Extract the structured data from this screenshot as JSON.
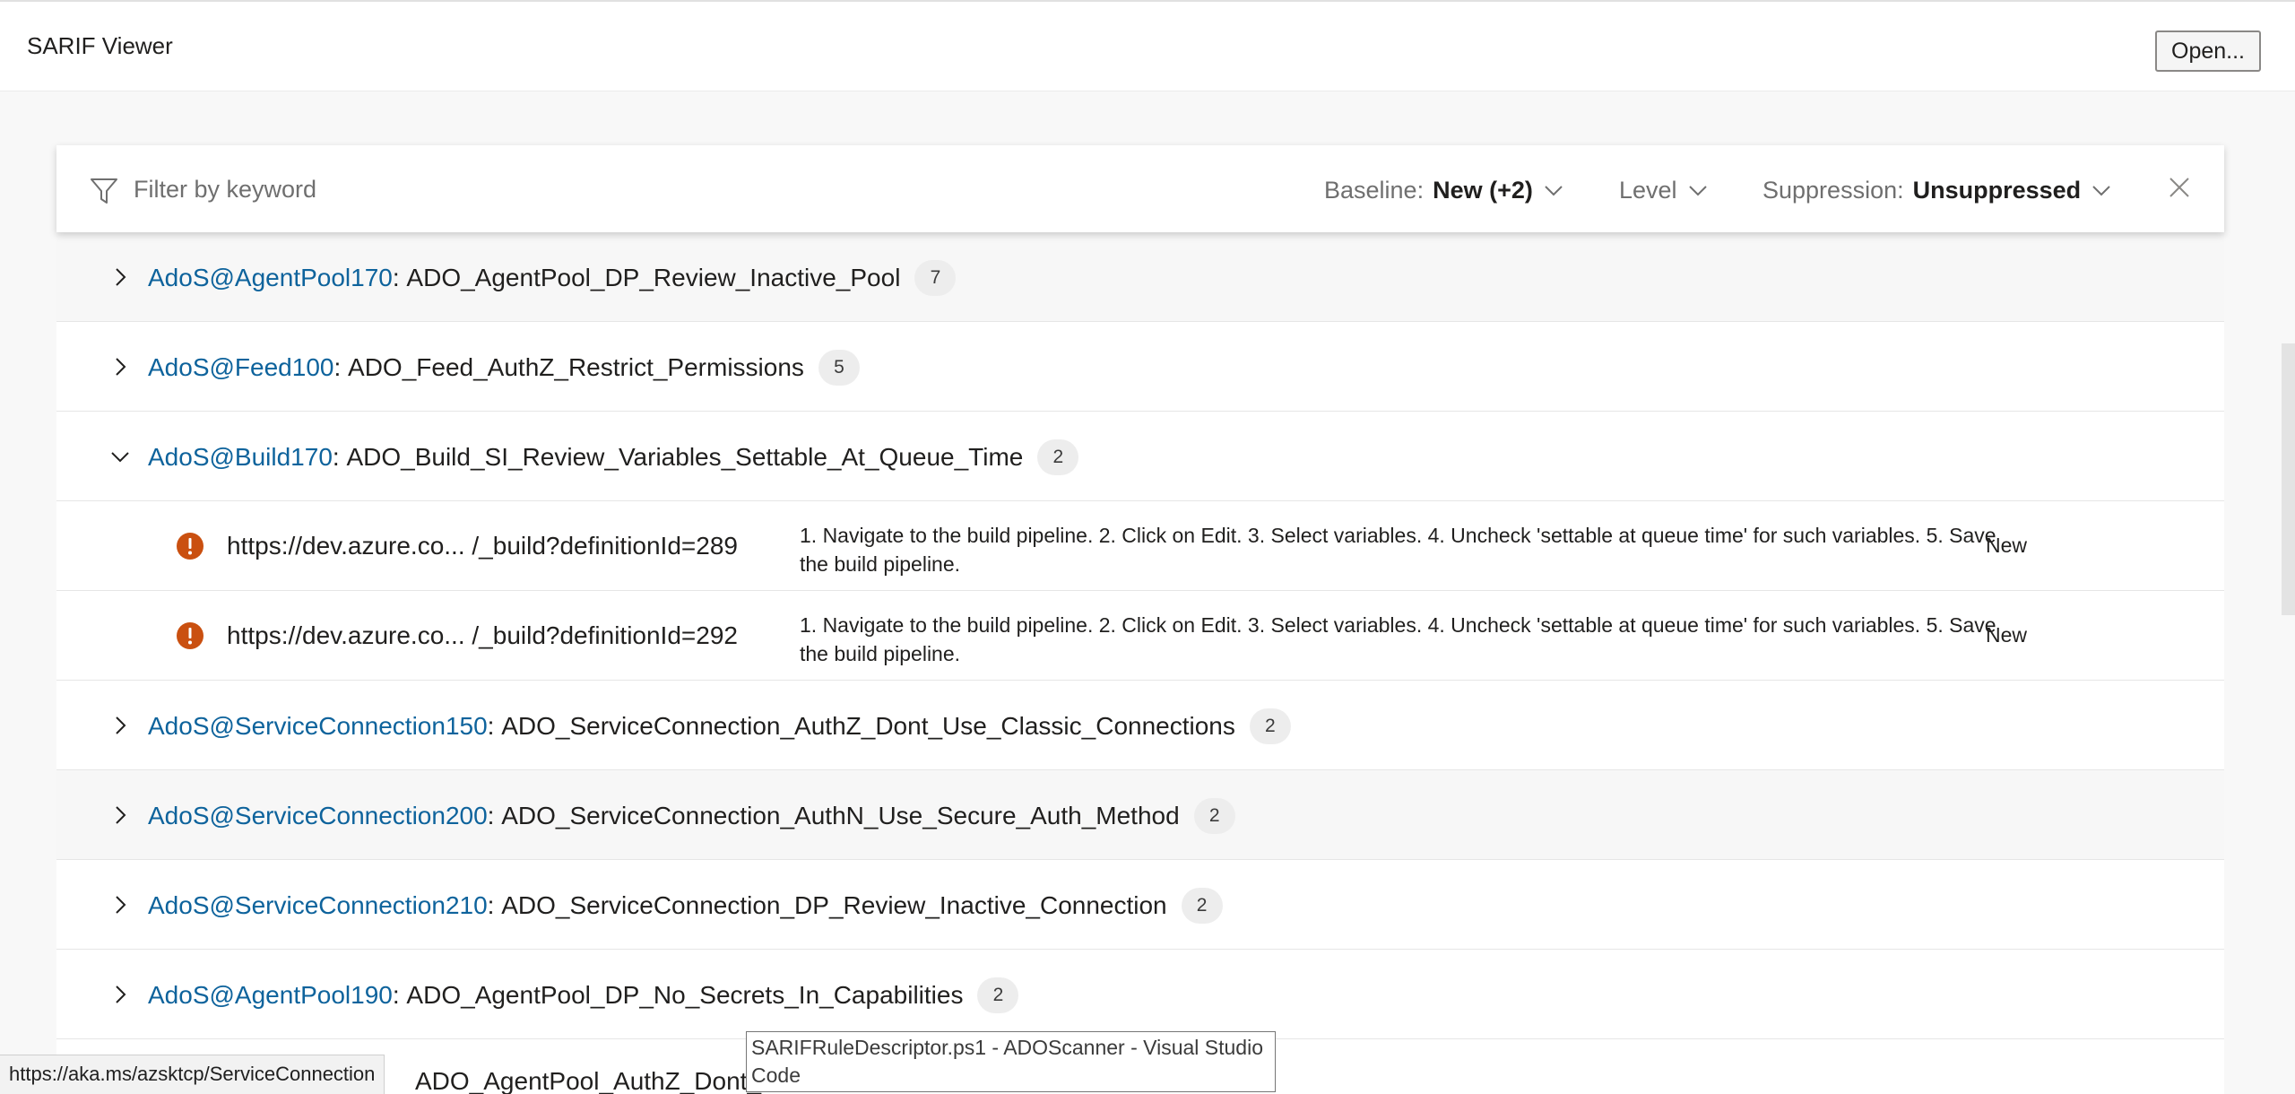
{
  "app": {
    "title": "SARIF Viewer",
    "open_label": "Open..."
  },
  "filter": {
    "placeholder": "Filter by keyword",
    "baseline": {
      "label": "Baseline:",
      "value": "New (+2)"
    },
    "level": {
      "label": "Level"
    },
    "suppression": {
      "label": "Suppression:",
      "value": "Unsuppressed"
    }
  },
  "rules": [
    {
      "id": "AdoS@AgentPool170",
      "sep": ":",
      "name": "ADO_AgentPool_DP_Review_Inactive_Pool",
      "count": "7",
      "expanded": false
    },
    {
      "id": "AdoS@Feed100",
      "sep": ":",
      "name": "ADO_Feed_AuthZ_Restrict_Permissions",
      "count": "5",
      "expanded": false
    },
    {
      "id": "AdoS@Build170",
      "sep": ":",
      "name": "ADO_Build_SI_Review_Variables_Settable_At_Queue_Time",
      "count": "2",
      "expanded": true,
      "results": [
        {
          "location": "https://dev.azure.co...  /_build?definitionId=289",
          "message": "1. Navigate to the build pipeline. 2. Click on Edit. 3. Select variables. 4. Uncheck 'settable at queue time' for such variables. 5. Save the build pipeline.",
          "baseline": "New"
        },
        {
          "location": "https://dev.azure.co...  /_build?definitionId=292",
          "message": "1. Navigate to the build pipeline. 2. Click on Edit. 3. Select variables. 4. Uncheck 'settable at queue time' for such variables. 5. Save the build pipeline.",
          "baseline": "New"
        }
      ]
    },
    {
      "id": "AdoS@ServiceConnection150",
      "sep": ":",
      "name": "ADO_ServiceConnection_AuthZ_Dont_Use_Classic_Connections",
      "count": "2",
      "expanded": false
    },
    {
      "id": "AdoS@ServiceConnection200",
      "sep": ":",
      "name": "ADO_ServiceConnection_AuthN_Use_Secure_Auth_Method",
      "count": "2",
      "expanded": false
    },
    {
      "id": "AdoS@ServiceConnection210",
      "sep": ":",
      "name": "ADO_ServiceConnection_DP_Review_Inactive_Connection",
      "count": "2",
      "expanded": false
    },
    {
      "id": "AdoS@AgentPool190",
      "sep": ":",
      "name": "ADO_AgentPool_DP_No_Secrets_In_Capabilities",
      "count": "2",
      "expanded": false
    },
    {
      "id": "",
      "sep": "",
      "name": "ADO_AgentPool_AuthZ_Dont_G",
      "count": "",
      "expanded": false
    }
  ],
  "status_url": "https://aka.ms/azsktcp/ServiceConnection",
  "tooltip": "SARIFRuleDescriptor.ps1 - ADOScanner - Visual Studio Code",
  "colors": {
    "link": "#0e639c",
    "error_icon": "#ca5010",
    "badge": "#ededed"
  },
  "icons": {
    "filter": "filter-icon",
    "chevron": "chevron-down-icon",
    "close": "close-icon",
    "caret": "chevron-right-icon",
    "error": "error-icon"
  }
}
